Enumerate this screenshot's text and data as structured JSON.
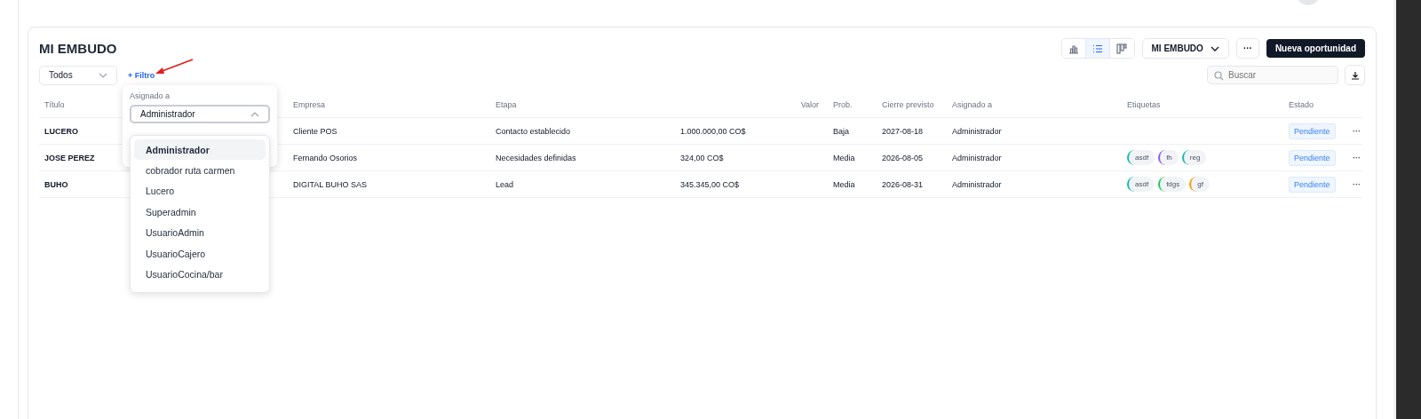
{
  "header": {
    "title": "MI EMBUDO",
    "views": [
      {
        "kind": "chart",
        "selected": false
      },
      {
        "kind": "list",
        "selected": true
      },
      {
        "kind": "board",
        "selected": false
      }
    ],
    "pipeline_button": "MI EMBUDO",
    "more_button": "···",
    "primary_button": "Nueva oportunidad"
  },
  "filters": {
    "status_select": "Todos",
    "add_filter": "+ Filtro",
    "search": {
      "placeholder": "Buscar"
    }
  },
  "filter_popover": {
    "label": "Asignado a",
    "value": "Administrador",
    "options": [
      {
        "label": "Administrador",
        "selected": true
      },
      {
        "label": "cobrador ruta carmen",
        "selected": false
      },
      {
        "label": "Lucero",
        "selected": false
      },
      {
        "label": "Superadmin",
        "selected": false
      },
      {
        "label": "UsuarioAdmin",
        "selected": false
      },
      {
        "label": "UsuarioCajero",
        "selected": false
      },
      {
        "label": "UsuarioCocina/bar",
        "selected": false
      }
    ]
  },
  "table": {
    "columns": [
      "Título",
      "Empresa",
      "Etapa",
      "Valor",
      "Prob.",
      "Cierre previsto",
      "Asignado a",
      "Etiquetas",
      "Estado"
    ],
    "rows": [
      {
        "title": "LUCERO",
        "company": "Cliente POS",
        "stage": "Contacto establecido",
        "value": "1.000.000,00 CO$",
        "prob": "Baja",
        "close": "2027-08-18",
        "assigned": "Administrador",
        "tags": [],
        "status": "Pendiente",
        "actions": "···"
      },
      {
        "title": "JOSE PEREZ",
        "company": "Fernando Osorios",
        "stage": "Necesidades definidas",
        "value": "324,00 CO$",
        "prob": "Media",
        "close": "2026-08-05",
        "assigned": "Administrador",
        "tags": [
          {
            "label": "asdf",
            "color": "#14b8b0"
          },
          {
            "label": "fh",
            "color": "#8b5cf6"
          },
          {
            "label": "reg",
            "color": "#14b8b0"
          }
        ],
        "status": "Pendiente",
        "actions": "···"
      },
      {
        "title": "BUHO",
        "company": "DIGITAL BUHO SAS",
        "stage": "Lead",
        "value": "345.345,00 CO$",
        "prob": "Media",
        "close": "2026-08-31",
        "assigned": "Administrador",
        "tags": [
          {
            "label": "asdf",
            "color": "#14b8b0"
          },
          {
            "label": "fdgs",
            "color": "#22c55e"
          },
          {
            "label": "gf",
            "color": "#f59e0b"
          }
        ],
        "status": "Pendiente",
        "actions": "···"
      }
    ]
  }
}
